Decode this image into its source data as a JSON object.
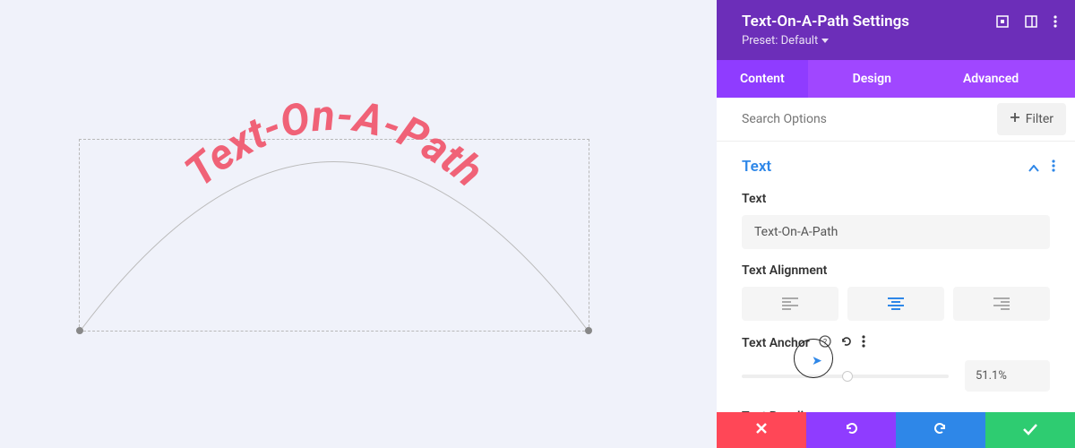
{
  "canvas": {
    "display_text": "Text-On-A-Path"
  },
  "panel": {
    "title": "Text-On-A-Path Settings",
    "preset_label": "Preset: Default",
    "tabs": {
      "content": "Content",
      "design": "Design",
      "advanced": "Advanced"
    },
    "search_placeholder": "Search Options",
    "filter_label": "Filter",
    "section_title": "Text",
    "fields": {
      "text_label": "Text",
      "text_value": "Text-On-A-Path",
      "alignment_label": "Text Alignment",
      "alignment_active": "center",
      "anchor_label": "Text Anchor",
      "anchor_value": "51.1%",
      "baseline_label": "Text Baseline"
    }
  },
  "colors": {
    "brand_purple": "#6c2eb9",
    "tab_purple": "#a047ff",
    "accent_blue": "#2e87e8",
    "text_pink": "#f06277"
  }
}
